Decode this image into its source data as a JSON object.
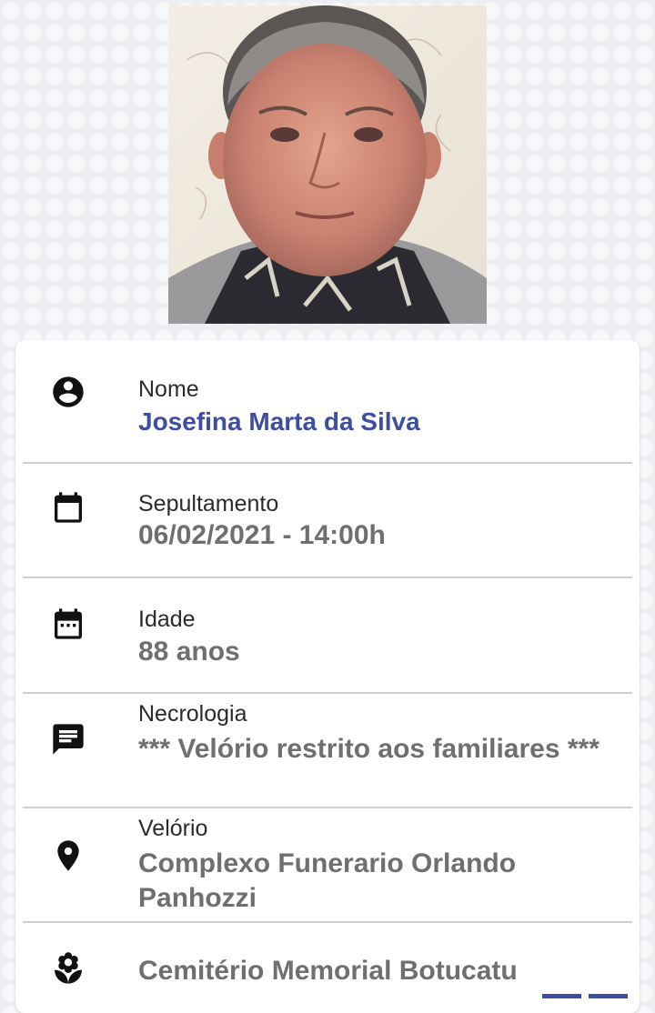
{
  "profile": {
    "photo_alt": "Josefina Marta da Silva"
  },
  "details": {
    "nome": {
      "label": "Nome",
      "value": "Josefina Marta da Silva",
      "icon": "account-circle-icon"
    },
    "sepultamento": {
      "label": "Sepultamento",
      "value": "06/02/2021 - 14:00h",
      "icon": "calendar-icon"
    },
    "idade": {
      "label": "Idade",
      "value": "88 anos",
      "icon": "calendar-dots-icon"
    },
    "necrologia": {
      "label": "Necrologia",
      "value": "*** Velório restrito aos familiares ***",
      "icon": "message-icon"
    },
    "velorio": {
      "label": "Velório",
      "value": "Complexo Funerario Orlando Panhozzi",
      "icon": "map-pin-icon"
    },
    "cemiterio": {
      "label": "",
      "value": "Cemitério Memorial Botucatu",
      "icon": "flower-icon"
    }
  },
  "colors": {
    "name_accent": "#3d4da0",
    "value_gray": "#6f6f6f",
    "label_dark": "#2b2b2b"
  }
}
